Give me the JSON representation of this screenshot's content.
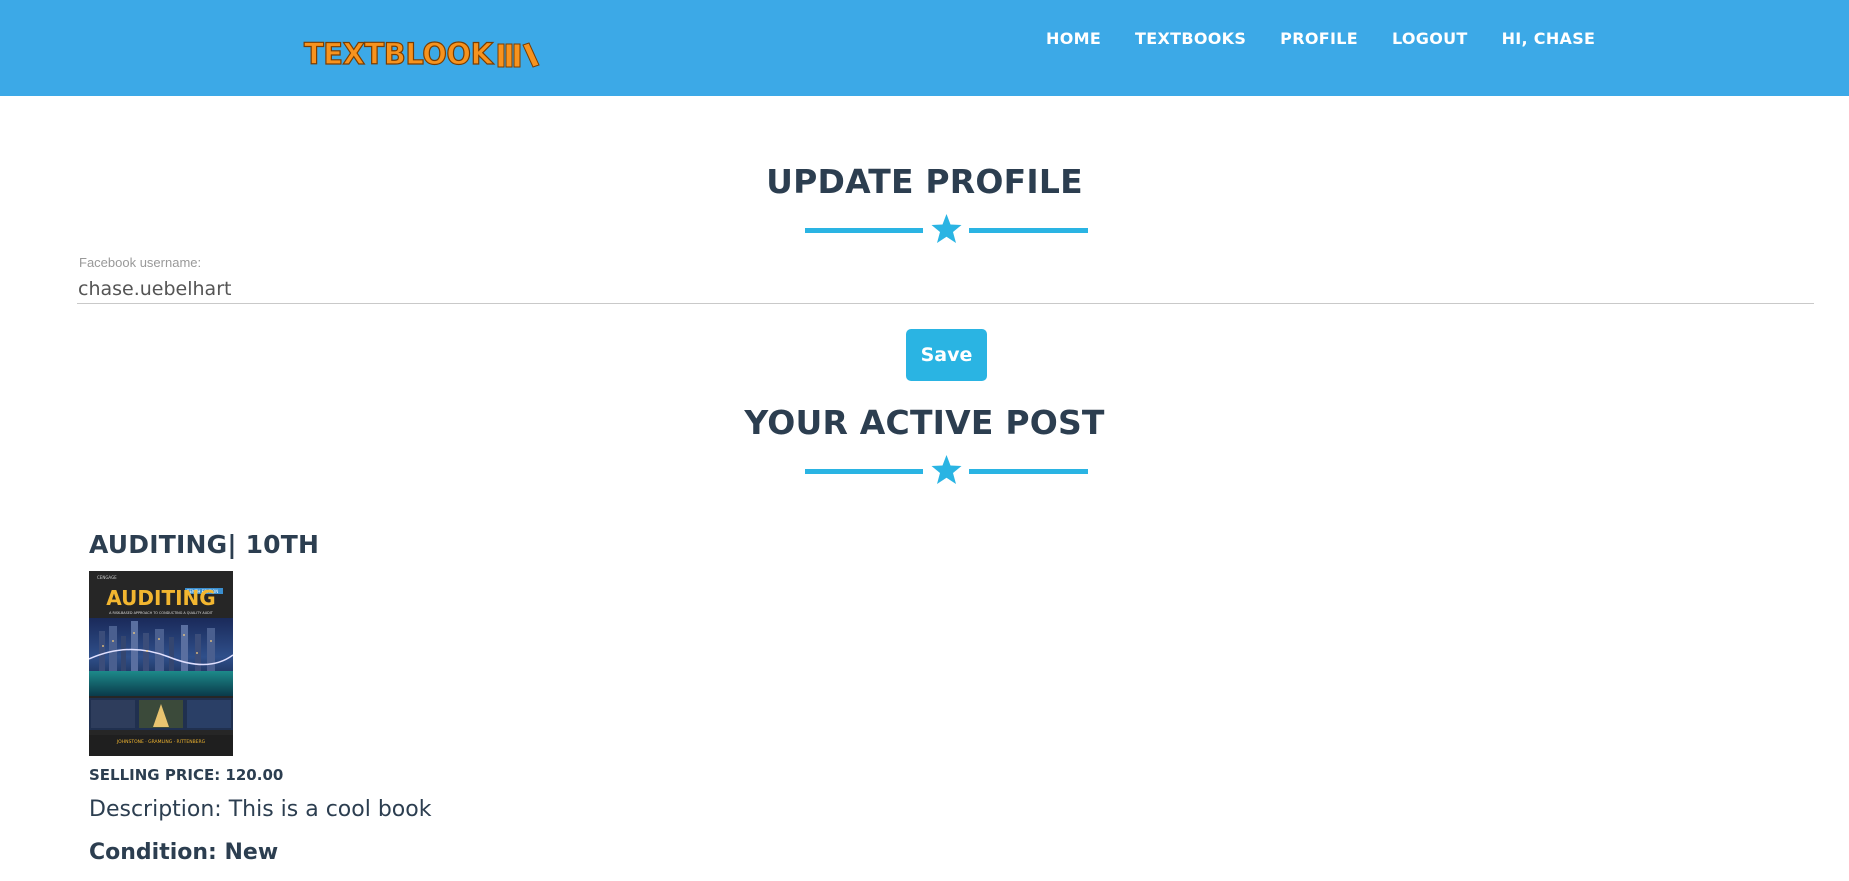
{
  "colors": {
    "navbar_bg": "#3ca9e7",
    "accent": "#2ab4e3",
    "heading": "#2c3e50",
    "brand_orange": "#f7931e"
  },
  "navbar": {
    "brand": "TEXTBLOOK",
    "brand_icon": "books-icon",
    "links": [
      {
        "label": "HOME"
      },
      {
        "label": "TEXTBOOKS"
      },
      {
        "label": "PROFILE"
      },
      {
        "label": "LOGOUT"
      },
      {
        "label": "HI, CHASE"
      }
    ]
  },
  "update_profile": {
    "title": "UPDATE PROFILE",
    "divider_icon": "star-icon",
    "field": {
      "label": "Facebook username:",
      "value": "chase.uebelhart"
    },
    "save_label": "Save"
  },
  "active_post": {
    "title": "YOUR ACTIVE POST",
    "divider_icon": "star-icon",
    "book": {
      "title": "AUDITING| 10TH",
      "cover": {
        "title": "AUDITING",
        "subtitle": "A RISK-BASED APPROACH TO CONDUCTING A QUALITY AUDIT",
        "authors": "JOHNSTONE · GRAMLING · RITTENBERG",
        "edition": "TENTH EDITION"
      },
      "price_text": "SELLING PRICE: 120.00",
      "description_text": "Description: This is a cool book",
      "condition_text": "Condition: New"
    }
  }
}
